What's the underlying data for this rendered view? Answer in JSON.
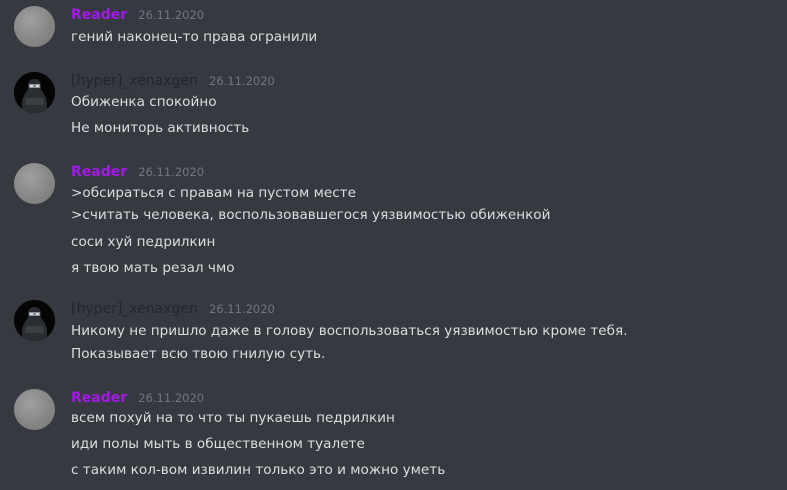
{
  "messages": [
    {
      "author": "Reader",
      "date": "26.11.2020",
      "lines": [
        "гений наконец-то права огранили"
      ]
    },
    {
      "author": "[hyper]_xenaxgen",
      "date": "26.11.2020",
      "lines": [
        "Обиженка спокойно",
        "Не мониторь активность"
      ]
    },
    {
      "author": "Reader",
      "date": "26.11.2020",
      "lines": [
        ">обсираться с правам на пустом месте",
        ">считать человека, воспользовавшегося уязвимостью обиженкой",
        "соси хуй педрилкин",
        "я твою мать резал чмо"
      ]
    },
    {
      "author": "[hyper]_xenaxgen",
      "date": "26.11.2020",
      "lines": [
        "Никому  не пришло даже в голову воспользоваться уязвимостью кроме тебя.",
        "Показывает всю твою гнилую суть."
      ]
    },
    {
      "author": "Reader",
      "date": "26.11.2020",
      "lines": [
        "всем похуй на то что ты пукаешь педрилкин",
        "иди полы мыть в общественном туалете",
        "с таким кол-вом извилин только это и можно уметь"
      ]
    }
  ],
  "colors": {
    "background": "#36393f",
    "reader_name": "#a319e8",
    "hyper_name": "#23262a",
    "timestamp": "#72767d",
    "text": "#dcddde"
  }
}
